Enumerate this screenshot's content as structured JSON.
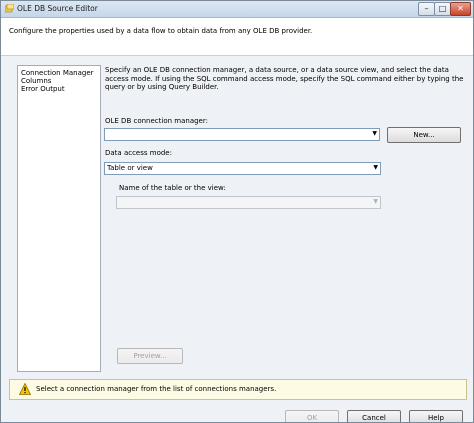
{
  "window": {
    "title": "OLE DB Source Editor"
  },
  "titlebar_controls": {
    "minimize": "–",
    "maximize": "□",
    "close": "✕"
  },
  "header": {
    "description": "Configure the properties used by a data flow to obtain data from any OLE DB provider."
  },
  "nav": {
    "items": [
      {
        "label": "Connection Manager"
      },
      {
        "label": "Columns"
      },
      {
        "label": "Error Output"
      }
    ]
  },
  "main": {
    "description": "Specify an OLE DB connection manager, a data source, or a data source view, and select the data access mode. If using the SQL command access mode, specify the SQL command either by typing the query or by using Query Builder.",
    "connection_manager_label": "OLE DB connection manager:",
    "connection_manager_value": "",
    "new_button": "New...",
    "access_mode_label": "Data access mode:",
    "access_mode_value": "Table or view",
    "table_label": "Name of the table or the view:",
    "table_value": "",
    "preview_button": "Preview..."
  },
  "status": {
    "message": "Select a connection manager from the list of connections managers."
  },
  "footer": {
    "ok": "OK",
    "cancel": "Cancel",
    "help": "Help"
  },
  "icons": {
    "app": "ole-db-source-icon",
    "warning": "warning-icon",
    "dropdown": "chevron-down-icon"
  },
  "colors": {
    "warning_bg": "#fdfbe3",
    "warning_icon": "#f5c400",
    "titlebar": "#dce7f3"
  }
}
